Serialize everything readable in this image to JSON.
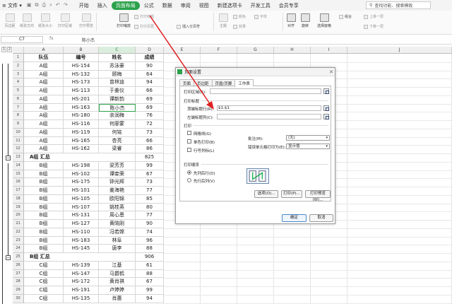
{
  "menubar": {
    "file_label": "文件",
    "tabs": [
      "开始",
      "插入",
      "页面布局",
      "公式",
      "数据",
      "审阅",
      "视图",
      "新建选项卡",
      "开发工具",
      "会员专享"
    ],
    "active_tab": "页面布局",
    "search_placeholder": "查找功能、搜索模板"
  },
  "ribbon": {
    "left_buttons": [
      "页边距",
      "纸张方向",
      "纸张大小",
      "打印区域",
      "打印预览"
    ],
    "print_title": "打印标题",
    "print_scale": "打印缩放",
    "header_footer": "打印页眉",
    "page_break": "插入分页符",
    "theme_items": [
      "主题",
      "颜色",
      "字体",
      "效果"
    ],
    "right_items": [
      "对齐",
      "旋转",
      "选择窗格",
      "组合",
      "上移一层",
      "下移一层"
    ]
  },
  "formula_bar": {
    "cell_ref": "C7",
    "fx": "fx",
    "content": "陈小杰"
  },
  "grid": {
    "columns": [
      "A",
      "B",
      "C",
      "D",
      "E",
      "F",
      "G",
      "H",
      "I",
      "J"
    ],
    "header_row": [
      "队伍",
      "编号",
      "姓名",
      "成绩"
    ],
    "rows": [
      [
        "2",
        "A组",
        "HS-154",
        "苏泳豪",
        "90"
      ],
      [
        "3",
        "A组",
        "HS-132",
        "顾梅",
        "64"
      ],
      [
        "4",
        "A组",
        "HS-173",
        "曾林迪",
        "94"
      ],
      [
        "5",
        "A组",
        "HS-113",
        "于姜仪",
        "66"
      ],
      [
        "6",
        "A组",
        "HS-201",
        "谭新韵",
        "69"
      ],
      [
        "7",
        "A组",
        "HS-163",
        "陈小杰",
        "69"
      ],
      [
        "8",
        "A组",
        "HS-180",
        "余润梅",
        "76"
      ],
      [
        "9",
        "A组",
        "HS-116",
        "何廖蒙",
        "72"
      ],
      [
        "10",
        "A组",
        "HS-119",
        "何铭",
        "73"
      ],
      [
        "11",
        "A组",
        "HS-165",
        "杏亮",
        "66"
      ],
      [
        "12",
        "A组",
        "HS-162",
        "梁睿",
        "86"
      ],
      [
        "13",
        "A组 汇总",
        "",
        "",
        "825"
      ],
      [
        "14",
        "B组",
        "HS-198",
        "梁芳芳",
        "99"
      ],
      [
        "15",
        "B组",
        "HS-102",
        "谭妾荣",
        "67"
      ],
      [
        "16",
        "B组",
        "HS-175",
        "钟光辉",
        "73"
      ],
      [
        "17",
        "B组",
        "HS-101",
        "姜海艳",
        "77"
      ],
      [
        "18",
        "B组",
        "HS-105",
        "欧阳锦",
        "85"
      ],
      [
        "19",
        "B组",
        "HS-107",
        "姚桂英",
        "80"
      ],
      [
        "20",
        "B组",
        "HS-131",
        "周心恩",
        "77"
      ],
      [
        "21",
        "B组",
        "HS-127",
        "黄晓刚",
        "90"
      ],
      [
        "22",
        "B组",
        "HS-110",
        "冯若嫦",
        "74"
      ],
      [
        "23",
        "B组",
        "HS-183",
        "林阜",
        "96"
      ],
      [
        "24",
        "B组",
        "HS-145",
        "唐李",
        "88"
      ],
      [
        "25",
        "B组 汇总",
        "",
        "",
        "906"
      ],
      [
        "26",
        "C组",
        "HS-139",
        "江基",
        "61"
      ],
      [
        "27",
        "C组",
        "HS-147",
        "马爵鹤",
        "88"
      ],
      [
        "28",
        "C组",
        "HS-172",
        "黄肖祺",
        "67"
      ],
      [
        "29",
        "C组",
        "HS-191",
        "卢婷婷",
        "99"
      ],
      [
        "30",
        "C组",
        "HS-135",
        "肖惠",
        "94"
      ]
    ]
  },
  "dialog": {
    "title": "页面设置",
    "tabs": [
      "页面",
      "页边距",
      "页眉/页脚",
      "工作表"
    ],
    "active_tab": "工作表",
    "print_area_label": "打印区域(A):",
    "print_titles_group": "打印标题",
    "top_rows_label": "顶端标题行(R):",
    "top_rows_value": "$1:$1",
    "left_cols_label": "左端标题列(C):",
    "print_group": "打印",
    "gridlines_label": "网格线(G)",
    "mono_label": "单色打印(B)",
    "rowcol_label": "行号列标(L)",
    "comments_label": "批注(M):",
    "comments_value": "(无)",
    "errors_label": "错误单元格打印为(E):",
    "errors_value": "显示值",
    "order_group": "打印顺序",
    "down_then_over": "先列后行(D)",
    "over_then_down": "先行后列(V)",
    "btn_options": "选项(O)...",
    "btn_print": "打印(P)...",
    "btn_preview": "打印预览(W)...",
    "btn_ok": "确定",
    "btn_cancel": "取消"
  },
  "colors": {
    "accent_green": "#2ba24a",
    "arrow_red": "#e02020"
  }
}
